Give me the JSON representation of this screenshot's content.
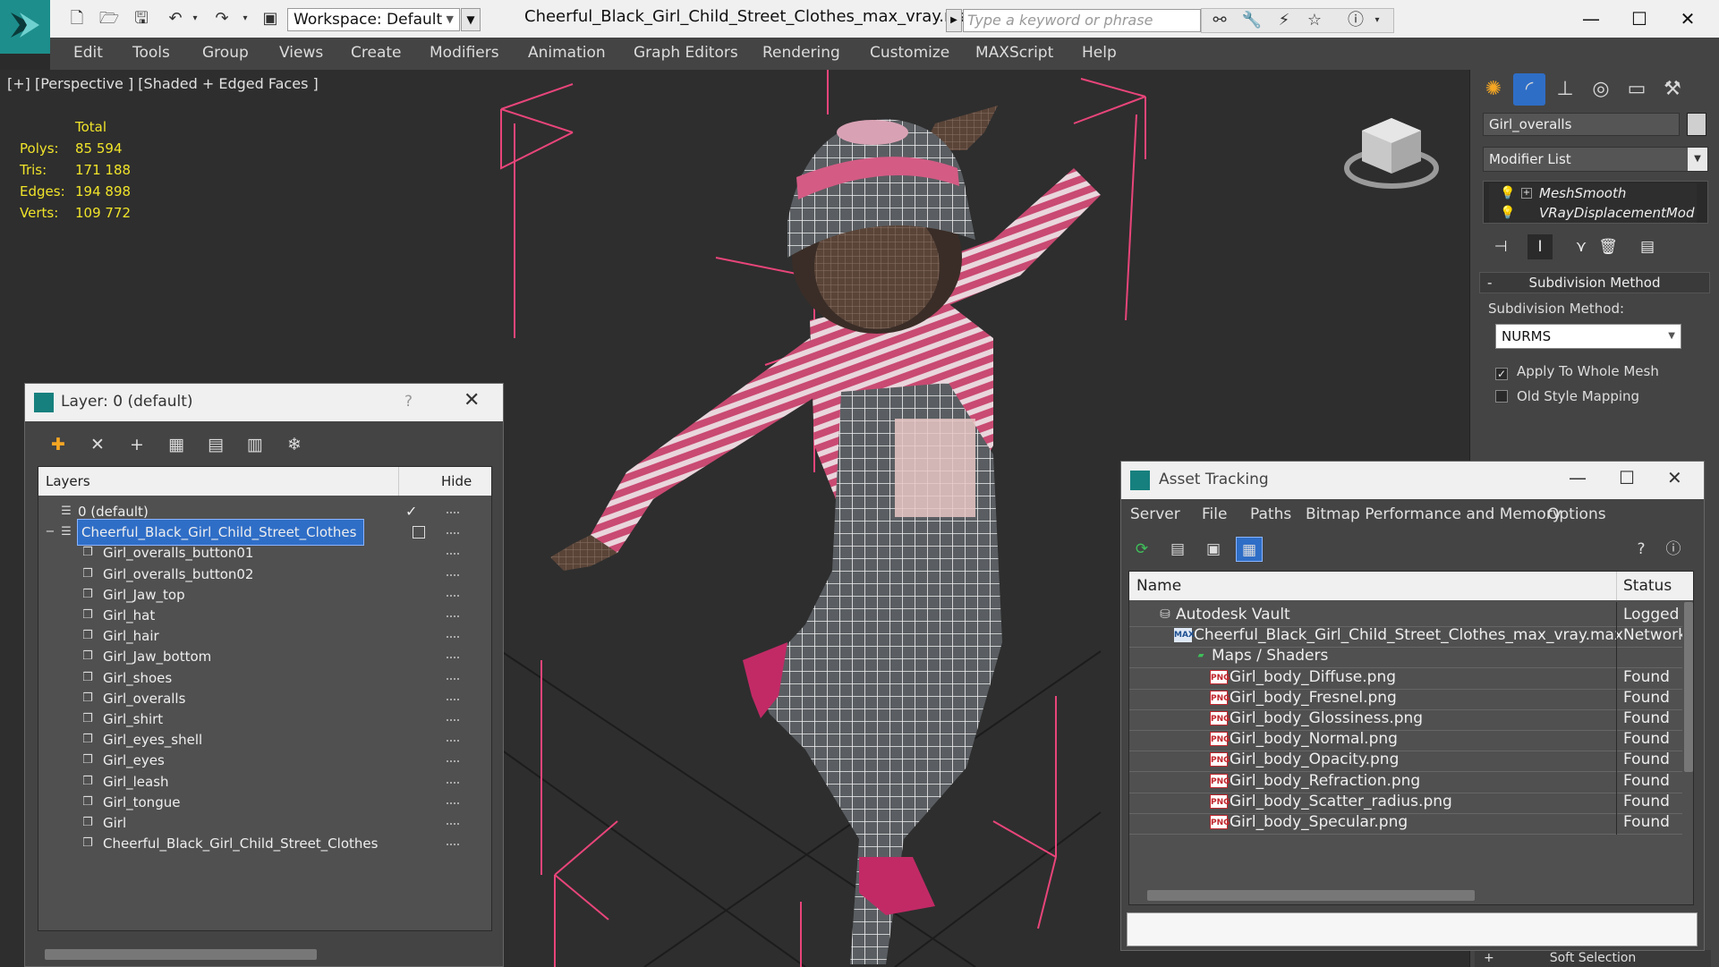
{
  "titlebar": {
    "workspace": "Workspace: Default",
    "doc_title": "Cheerful_Black_Girl_Child_Street_Clothes_max_vray.max",
    "search_placeholder": "Type a keyword or phrase"
  },
  "menu": [
    "Edit",
    "Tools",
    "Group",
    "Views",
    "Create",
    "Modifiers",
    "Animation",
    "Graph Editors",
    "Rendering",
    "Customize",
    "MAXScript",
    "Help"
  ],
  "viewport": {
    "label": "[+] [Perspective ] [Shaded + Edged Faces ]",
    "stats": {
      "total_label": "Total",
      "rows": [
        {
          "label": "Polys:",
          "value": "85 594"
        },
        {
          "label": "Tris:",
          "value": "171 188"
        },
        {
          "label": "Edges:",
          "value": "194 898"
        },
        {
          "label": "Verts:",
          "value": "109 772"
        }
      ]
    }
  },
  "command_panel": {
    "object_name": "Girl_overalls",
    "modifier_list": "Modifier List",
    "stack": [
      "MeshSmooth",
      "VRayDisplacementMod"
    ],
    "rollout_title": "Subdivision Method",
    "subdiv_label": "Subdivision Method:",
    "subdiv_value": "NURMS",
    "apply_whole_mesh": "Apply To Whole Mesh",
    "old_style_mapping": "Old Style Mapping",
    "soft_selection": "Soft Selection"
  },
  "layer_dialog": {
    "title": "Layer: 0 (default)",
    "help": "?",
    "col_layers": "Layers",
    "col_hide": "Hide",
    "rows": [
      {
        "name": "0 (default)",
        "level": 0,
        "checked": true
      },
      {
        "name": "Cheerful_Black_Girl_Child_Street_Clothes",
        "level": 0,
        "selected": true
      },
      {
        "name": "Girl_overalls_button01",
        "level": 1
      },
      {
        "name": "Girl_overalls_button02",
        "level": 1
      },
      {
        "name": "Girl_Jaw_top",
        "level": 1
      },
      {
        "name": "Girl_hat",
        "level": 1
      },
      {
        "name": "Girl_hair",
        "level": 1
      },
      {
        "name": "Girl_Jaw_bottom",
        "level": 1
      },
      {
        "name": "Girl_shoes",
        "level": 1
      },
      {
        "name": "Girl_overalls",
        "level": 1
      },
      {
        "name": "Girl_shirt",
        "level": 1
      },
      {
        "name": "Girl_eyes_shell",
        "level": 1
      },
      {
        "name": "Girl_eyes",
        "level": 1
      },
      {
        "name": "Girl_leash",
        "level": 1
      },
      {
        "name": "Girl_tongue",
        "level": 1
      },
      {
        "name": "Girl",
        "level": 1
      },
      {
        "name": "Cheerful_Black_Girl_Child_Street_Clothes",
        "level": 1
      }
    ]
  },
  "asset_dialog": {
    "title": "Asset Tracking",
    "menu": [
      "Server",
      "File",
      "Paths",
      "Bitmap Performance and Memory",
      "Options"
    ],
    "col_name": "Name",
    "col_status": "Status",
    "rows": [
      {
        "name": "Autodesk Vault",
        "status": "Logged Out",
        "level": 0,
        "icon": "vault"
      },
      {
        "name": "Cheerful_Black_Girl_Child_Street_Clothes_max_vray.max",
        "status": "Network",
        "level": 1,
        "icon": "max"
      },
      {
        "name": "Maps / Shaders",
        "status": "",
        "level": 2,
        "icon": "maps"
      },
      {
        "name": "Girl_body_Diffuse.png",
        "status": "Found",
        "level": 3,
        "icon": "png"
      },
      {
        "name": "Girl_body_Fresnel.png",
        "status": "Found",
        "level": 3,
        "icon": "png"
      },
      {
        "name": "Girl_body_Glossiness.png",
        "status": "Found",
        "level": 3,
        "icon": "png"
      },
      {
        "name": "Girl_body_Normal.png",
        "status": "Found",
        "level": 3,
        "icon": "png"
      },
      {
        "name": "Girl_body_Opacity.png",
        "status": "Found",
        "level": 3,
        "icon": "png"
      },
      {
        "name": "Girl_body_Refraction.png",
        "status": "Found",
        "level": 3,
        "icon": "png"
      },
      {
        "name": "Girl_body_Scatter_radius.png",
        "status": "Found",
        "level": 3,
        "icon": "png"
      },
      {
        "name": "Girl_body_Specular.png",
        "status": "Found",
        "level": 3,
        "icon": "png"
      }
    ],
    "png_badge": "PNG"
  },
  "colors": {
    "selection_blue": "#2f6ec7",
    "stats_yellow": "#f0e32a",
    "bbox_pink": "#e8457a",
    "brand_teal": "#1d8e8c"
  }
}
